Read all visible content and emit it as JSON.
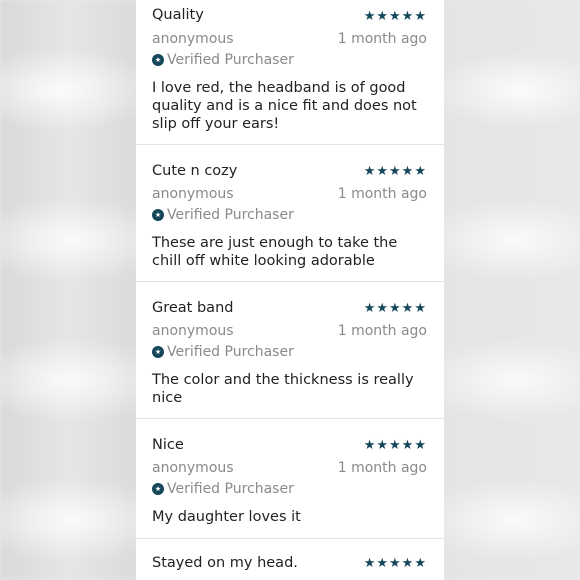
{
  "reviews": [
    {
      "title": "Quality",
      "stars": "★★★★★",
      "author": "anonymous",
      "date": "1 month ago",
      "verified": "Verified Purchaser",
      "body": "I love red, the headband is of good quality and is a nice fit and does not slip off your ears!"
    },
    {
      "title": "Cute n cozy",
      "stars": "★★★★★",
      "author": "anonymous",
      "date": "1 month ago",
      "verified": "Verified Purchaser",
      "body": "These are just enough to take the chill off white looking adorable"
    },
    {
      "title": "Great band",
      "stars": "★★★★★",
      "author": "anonymous",
      "date": "1 month ago",
      "verified": "Verified Purchaser",
      "body": "The color and the thickness is really nice"
    },
    {
      "title": "Nice",
      "stars": "★★★★★",
      "author": "anonymous",
      "date": "1 month ago",
      "verified": "Verified Purchaser",
      "body": "My daughter loves it"
    },
    {
      "title": "Stayed on my head.",
      "stars": "★★★★★"
    }
  ],
  "rating_max": 5,
  "ratings": [
    5,
    5,
    5,
    5,
    5
  ],
  "colors": {
    "accent": "#15475b",
    "muted_text": "#8a8a8a",
    "primary_text": "#222222",
    "divider": "#e2e2e2"
  },
  "icons": {
    "star": "star-icon",
    "verified": "verified-badge-icon"
  }
}
